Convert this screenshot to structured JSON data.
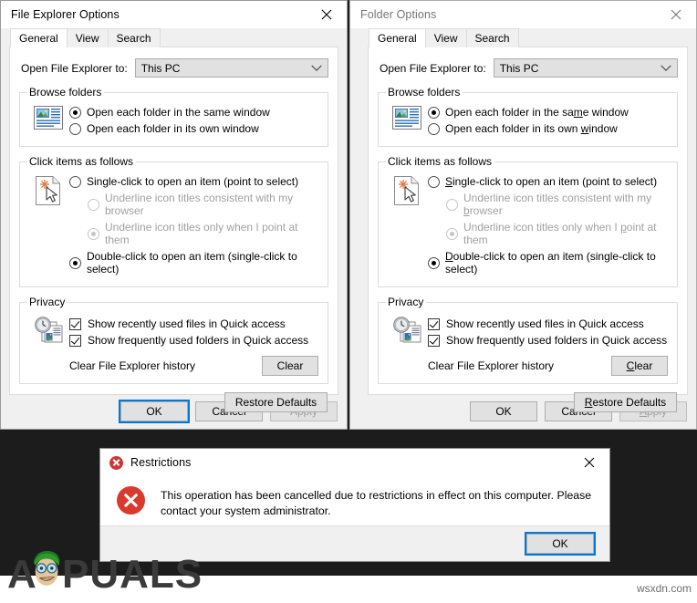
{
  "desktop": {
    "background_color": "#1c1c1c",
    "lower_band_color": "#ffffff"
  },
  "watermarks": {
    "brand_text": "APPUALS",
    "site_text": "wsxdn.com"
  },
  "dialog_left": {
    "title": "File Explorer Options",
    "active": true,
    "close_icon": "close-icon",
    "tabs": [
      {
        "label": "General",
        "active": true
      },
      {
        "label": "View",
        "active": false
      },
      {
        "label": "Search",
        "active": false
      }
    ],
    "open_to": {
      "label": "Open File Explorer to:",
      "value": "This PC",
      "arrow_icon": "chevron-down-icon"
    },
    "browse_folders": {
      "legend": "Browse folders",
      "icon": "folder-window-icon",
      "options": [
        {
          "label": "Open each folder in the same window",
          "checked": true
        },
        {
          "label": "Open each folder in its own window",
          "checked": false
        }
      ]
    },
    "click_items": {
      "legend": "Click items as follows",
      "icon": "pointer-click-icon",
      "options": [
        {
          "label": "Single-click to open an item (point to select)",
          "checked": false,
          "disabled": false
        },
        {
          "label": "Underline icon titles consistent with my browser",
          "checked": false,
          "disabled": true
        },
        {
          "label": "Underline icon titles only when I point at them",
          "checked": true,
          "disabled": true
        },
        {
          "label": "Double-click to open an item (single-click to select)",
          "checked": true,
          "disabled": false
        }
      ]
    },
    "privacy": {
      "legend": "Privacy",
      "icon": "clock-documents-icon",
      "checkboxes": [
        {
          "label": "Show recently used files in Quick access",
          "checked": true
        },
        {
          "label": "Show frequently used folders in Quick access",
          "checked": true
        }
      ],
      "clear_label": "Clear File Explorer history",
      "clear_button": "Clear"
    },
    "restore_defaults_button": "Restore Defaults",
    "footer": {
      "ok": "OK",
      "cancel": "Cancel",
      "apply": "Apply",
      "apply_disabled": true,
      "ok_focused": true
    }
  },
  "dialog_right": {
    "title": "Folder Options",
    "active": false,
    "close_icon": "close-icon",
    "tabs": [
      {
        "label": "General",
        "active": true
      },
      {
        "label": "View",
        "active": false
      },
      {
        "label": "Search",
        "active": false
      }
    ],
    "open_to": {
      "label": "Open File Explorer to:",
      "value": "This PC",
      "arrow_icon": "chevron-down-icon"
    },
    "browse_folders": {
      "legend": "Browse folders",
      "icon": "folder-window-icon",
      "options": [
        {
          "label": "Open each folder in the same window",
          "checked": true,
          "accel": "m"
        },
        {
          "label": "Open each folder in its own window",
          "checked": false,
          "accel": "w"
        }
      ]
    },
    "click_items": {
      "legend": "Click items as follows",
      "icon": "pointer-click-icon",
      "options": [
        {
          "label": "Single-click to open an item (point to select)",
          "checked": false,
          "disabled": false,
          "accel": "S"
        },
        {
          "label": "Underline icon titles consistent with my browser",
          "checked": false,
          "disabled": true,
          "accel": "b"
        },
        {
          "label": "Underline icon titles only when I point at them",
          "checked": true,
          "disabled": true,
          "accel": "p"
        },
        {
          "label": "Double-click to open an item (single-click to select)",
          "checked": true,
          "disabled": false,
          "accel": "D"
        }
      ]
    },
    "privacy": {
      "legend": "Privacy",
      "icon": "clock-documents-icon",
      "checkboxes": [
        {
          "label": "Show recently used files in Quick access",
          "checked": true
        },
        {
          "label": "Show frequently used folders in Quick access",
          "checked": true
        }
      ],
      "clear_label": "Clear File Explorer history",
      "clear_button": "Clear"
    },
    "restore_defaults_button": "Restore Defaults",
    "footer": {
      "ok": "OK",
      "cancel": "Cancel",
      "apply": "Apply",
      "apply_disabled": true,
      "ok_focused": false
    }
  },
  "restrictions_dialog": {
    "title": "Restrictions",
    "icon": "error-icon",
    "close_icon": "close-icon",
    "message": "This operation has been cancelled due to restrictions in effect on this computer. Please contact your system administrator.",
    "ok_button": "OK",
    "accent_color": "#0078d7",
    "error_color": "#d93a2e"
  }
}
